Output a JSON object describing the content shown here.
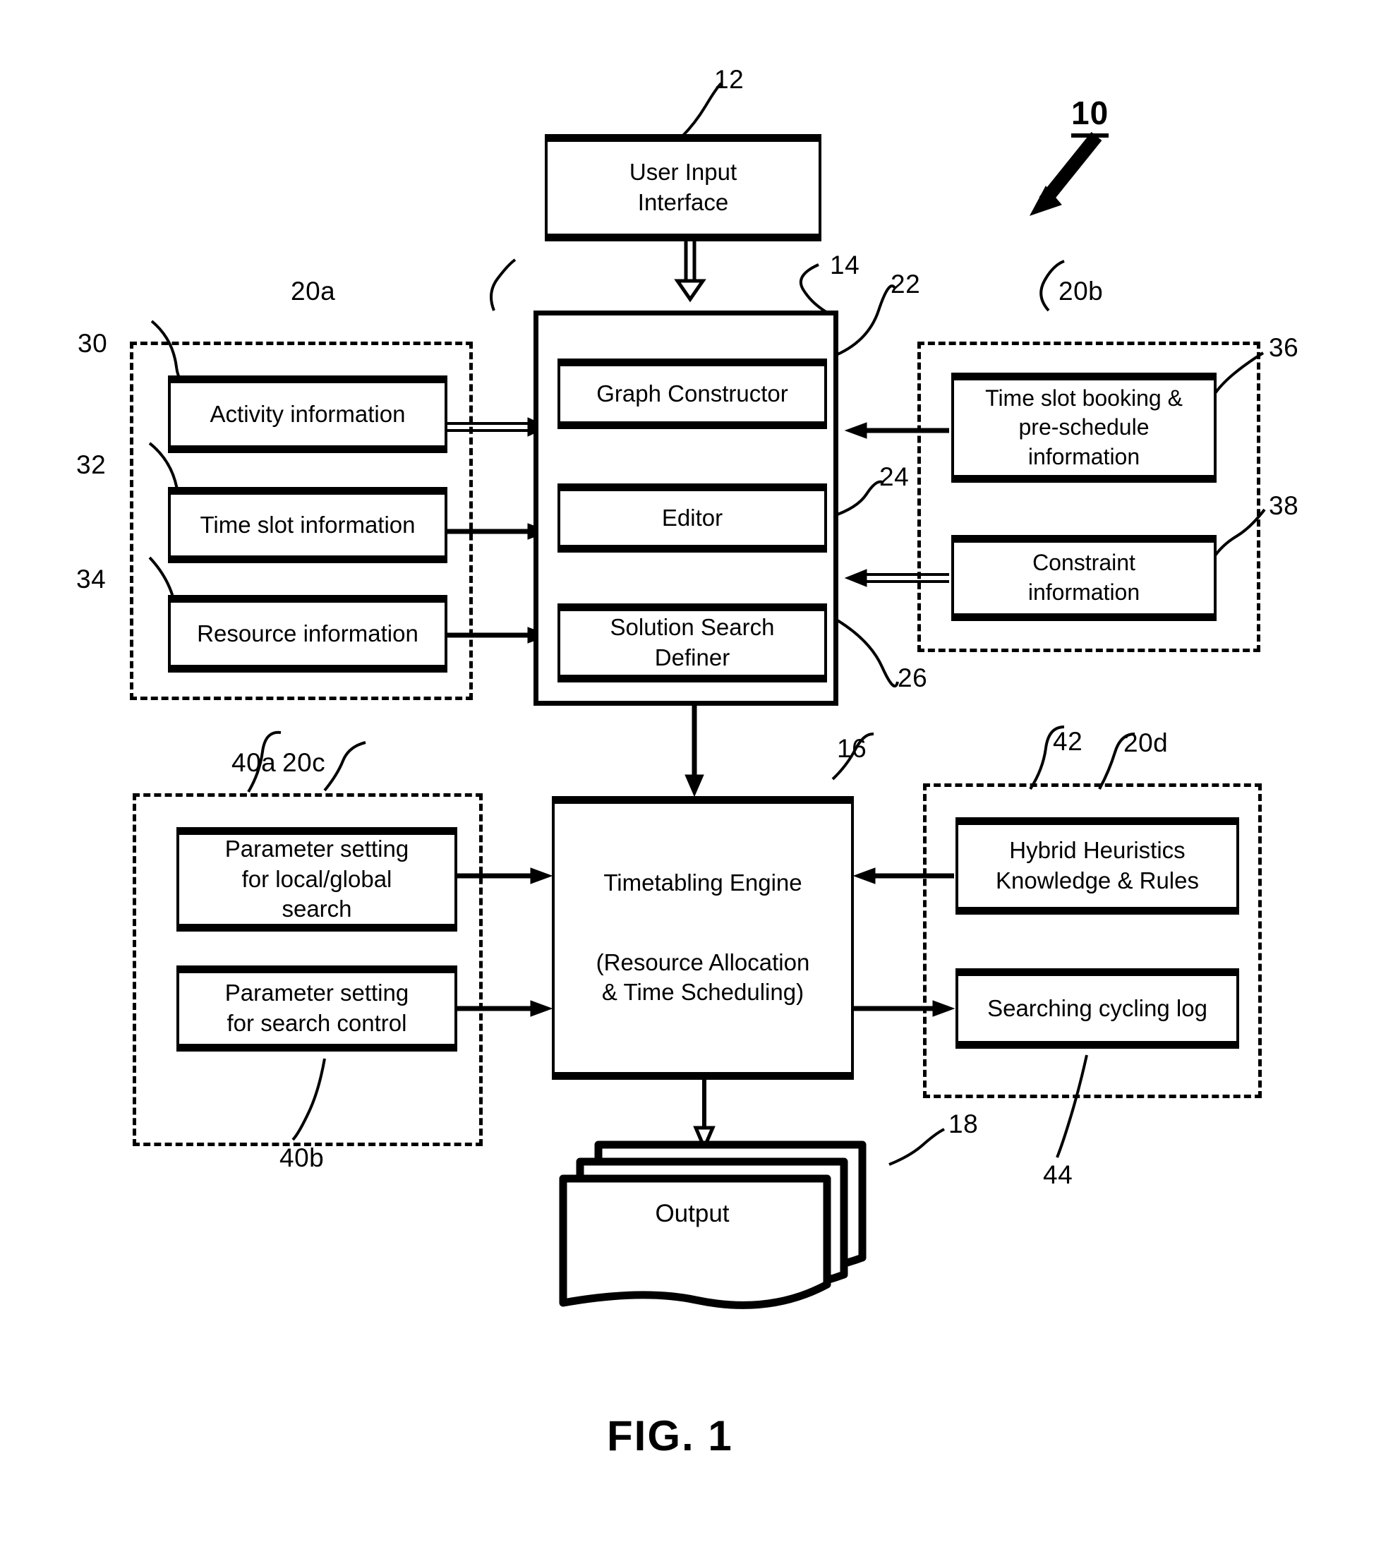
{
  "figure": {
    "caption": "FIG. 1",
    "system_numeral": "10"
  },
  "blocks": {
    "user_input_interface": {
      "label": "User Input\nInterface",
      "numeral": "12"
    },
    "core_module": {
      "numeral": "14"
    },
    "graph_constructor": {
      "label": "Graph Constructor",
      "numeral": "22"
    },
    "editor": {
      "label": "Editor",
      "numeral": "24"
    },
    "solution_search_definer": {
      "label": "Solution Search\nDefiner",
      "numeral": "26"
    },
    "timetabling_engine": {
      "label": "Timetabling Engine",
      "sublabel": "(Resource Allocation\n& Time Scheduling)",
      "numeral": "16"
    },
    "output": {
      "label": "Output",
      "numeral": "18"
    }
  },
  "groups": {
    "input_data": {
      "numeral": "20a",
      "items": [
        {
          "label": "Activity information",
          "numeral": "30"
        },
        {
          "label": "Time slot information",
          "numeral": "32"
        },
        {
          "label": "Resource information",
          "numeral": "34"
        }
      ]
    },
    "booking_constraints": {
      "numeral": "20b",
      "items": [
        {
          "label": "Time slot booking &\npre-schedule\ninformation",
          "numeral": "36"
        },
        {
          "label": "Constraint\ninformation",
          "numeral": "38"
        }
      ]
    },
    "parameters": {
      "numeral": "20c",
      "items": [
        {
          "label": "Parameter setting\nfor local/global\nsearch",
          "numeral": "40a"
        },
        {
          "label": "Parameter setting\nfor search control",
          "numeral": "40b"
        }
      ]
    },
    "heuristics": {
      "numeral": "20d",
      "items": [
        {
          "label": "Hybrid Heuristics\nKnowledge & Rules",
          "numeral": "42"
        },
        {
          "label": "Searching cycling log",
          "numeral": "44"
        }
      ]
    }
  },
  "colors": {
    "ink": "#000000",
    "paper": "#ffffff"
  }
}
